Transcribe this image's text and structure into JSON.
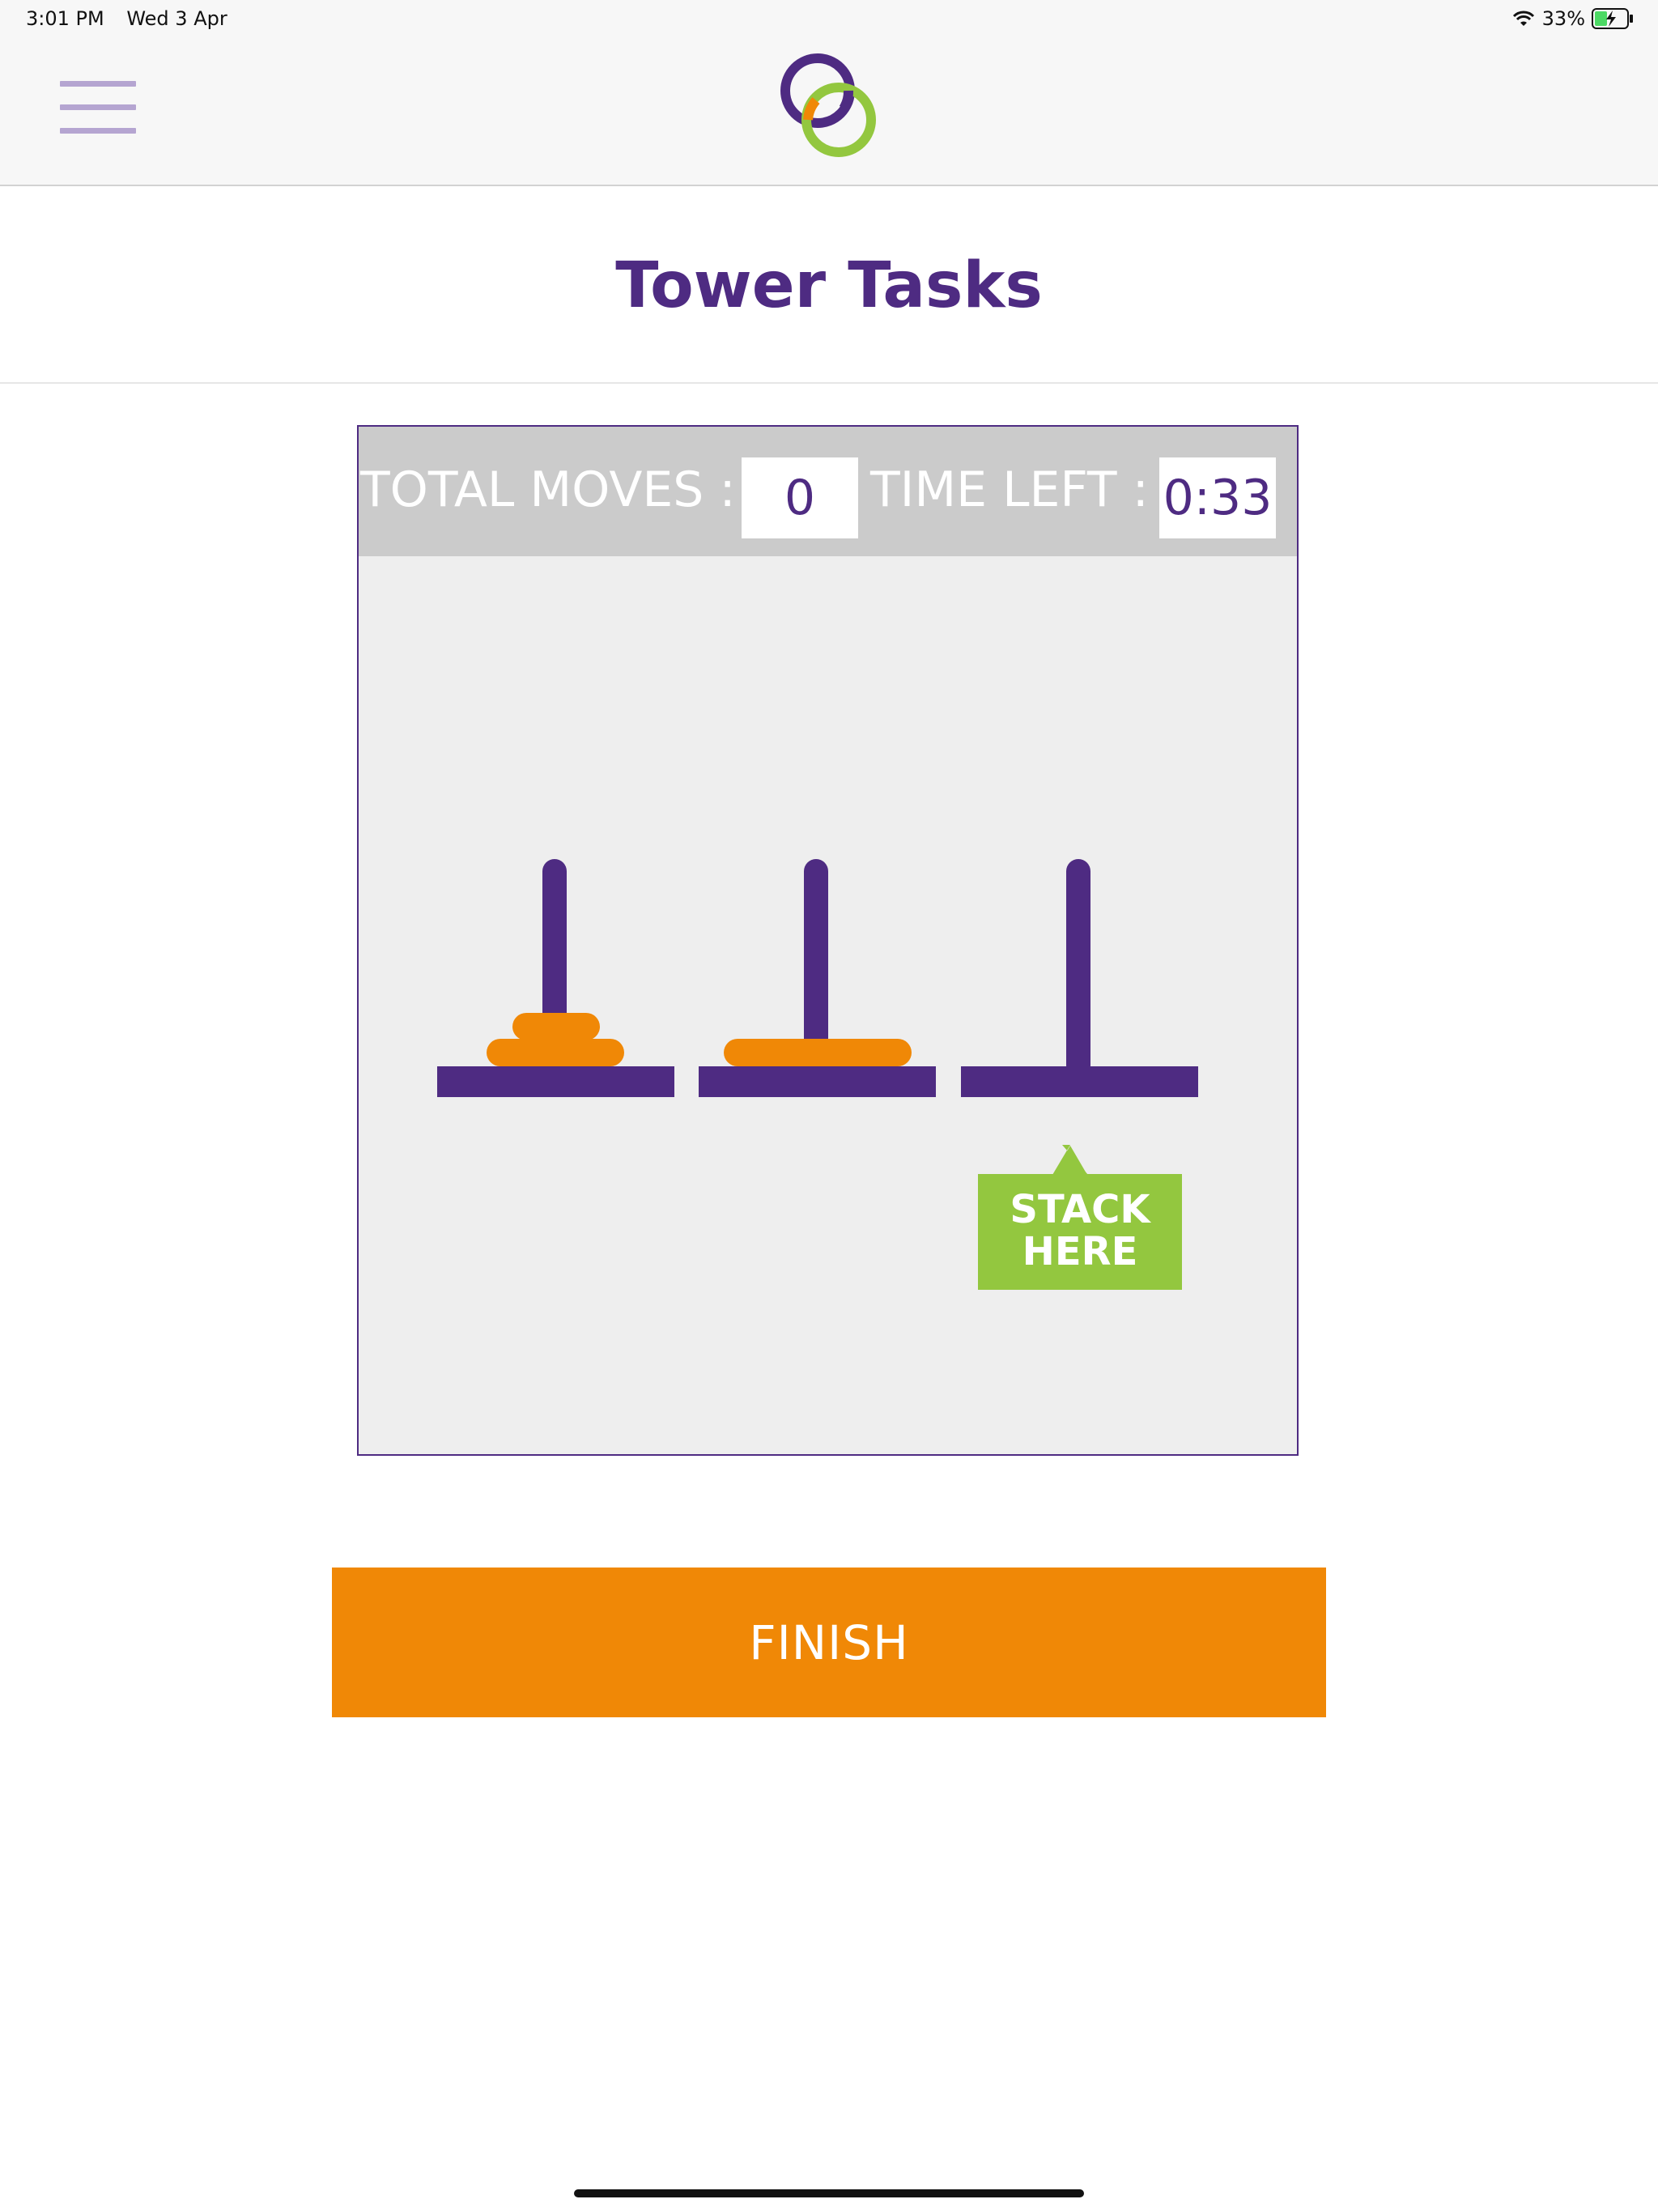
{
  "status_bar": {
    "time": "3:01 PM",
    "date": "Wed 3 Apr",
    "battery": "33%",
    "battery_color": "#4cd964"
  },
  "nav": {
    "menu_icon": "hamburger-menu-icon",
    "logo_icon": "interlocking-rings-logo"
  },
  "page": {
    "title": "Tower Tasks"
  },
  "game": {
    "total_moves_label": "TOTAL MOVES :",
    "total_moves_value": "0",
    "time_left_label": "TIME LEFT :",
    "time_left_value": "0:33",
    "pegs": [
      {
        "peg": 1,
        "discs": [
          "large",
          "small"
        ]
      },
      {
        "peg": 2,
        "discs": [
          "largest"
        ]
      },
      {
        "peg": 3,
        "discs": []
      }
    ],
    "target_line1": "STACK",
    "target_line2": "HERE",
    "colors": {
      "peg": "#4e2b82",
      "disc": "#f08806",
      "target": "#93c73f",
      "header": "#cbcbcb",
      "board": "#eeeeee"
    }
  },
  "actions": {
    "finish_label": "FINISH"
  }
}
